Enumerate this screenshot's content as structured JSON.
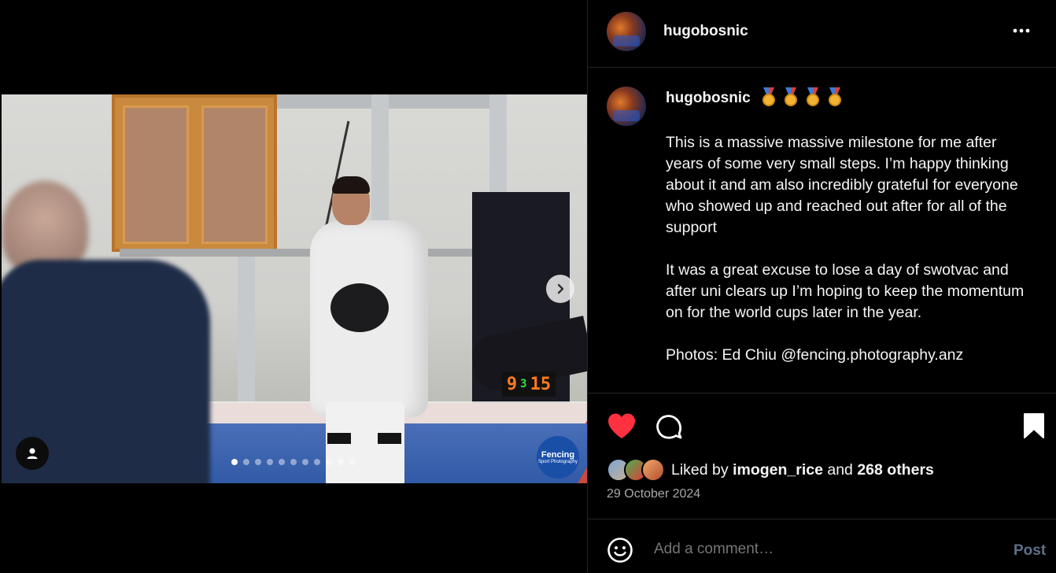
{
  "post": {
    "username": "hugobosnic",
    "medals_count": 4,
    "caption_paragraphs": [
      "This is a massive massive milestone for me after years of some very small steps. I’m happy thinking about it and am also incredibly grateful for everyone who showed up and reached out after for all of the support",
      "It was a great excuse to lose a day of swotvac and after uni clears up I’m hoping to keep the momentum on for the world cups later in the year.",
      "Photos: Ed Chiu @fencing.photography.anz"
    ],
    "liked_by_prefix": "Liked by ",
    "liked_by_user": "imogen_rice",
    "liked_by_joiner": " and ",
    "liked_by_others": "268 others",
    "date": "29 October 2024",
    "liked": true
  },
  "media": {
    "carousel_total": 11,
    "carousel_active": 1,
    "scoreboard_left": "9",
    "scoreboard_mid": "3",
    "scoreboard_right": "15",
    "watermark_title": "Fencing",
    "watermark_sub": "Sport Photography"
  },
  "comment": {
    "placeholder": "Add a comment…",
    "post_label": "Post"
  },
  "icons": {
    "more": "more-options-icon",
    "like": "heart-icon",
    "comment": "comment-icon",
    "save": "bookmark-icon",
    "emoji": "emoji-icon",
    "next": "chevron-right-icon",
    "tag": "user-tag-icon"
  },
  "colors": {
    "heart": "#ff3040",
    "muted_text": "#a8a8a8",
    "post_button": "#5f6f8a",
    "divider": "#262626"
  }
}
